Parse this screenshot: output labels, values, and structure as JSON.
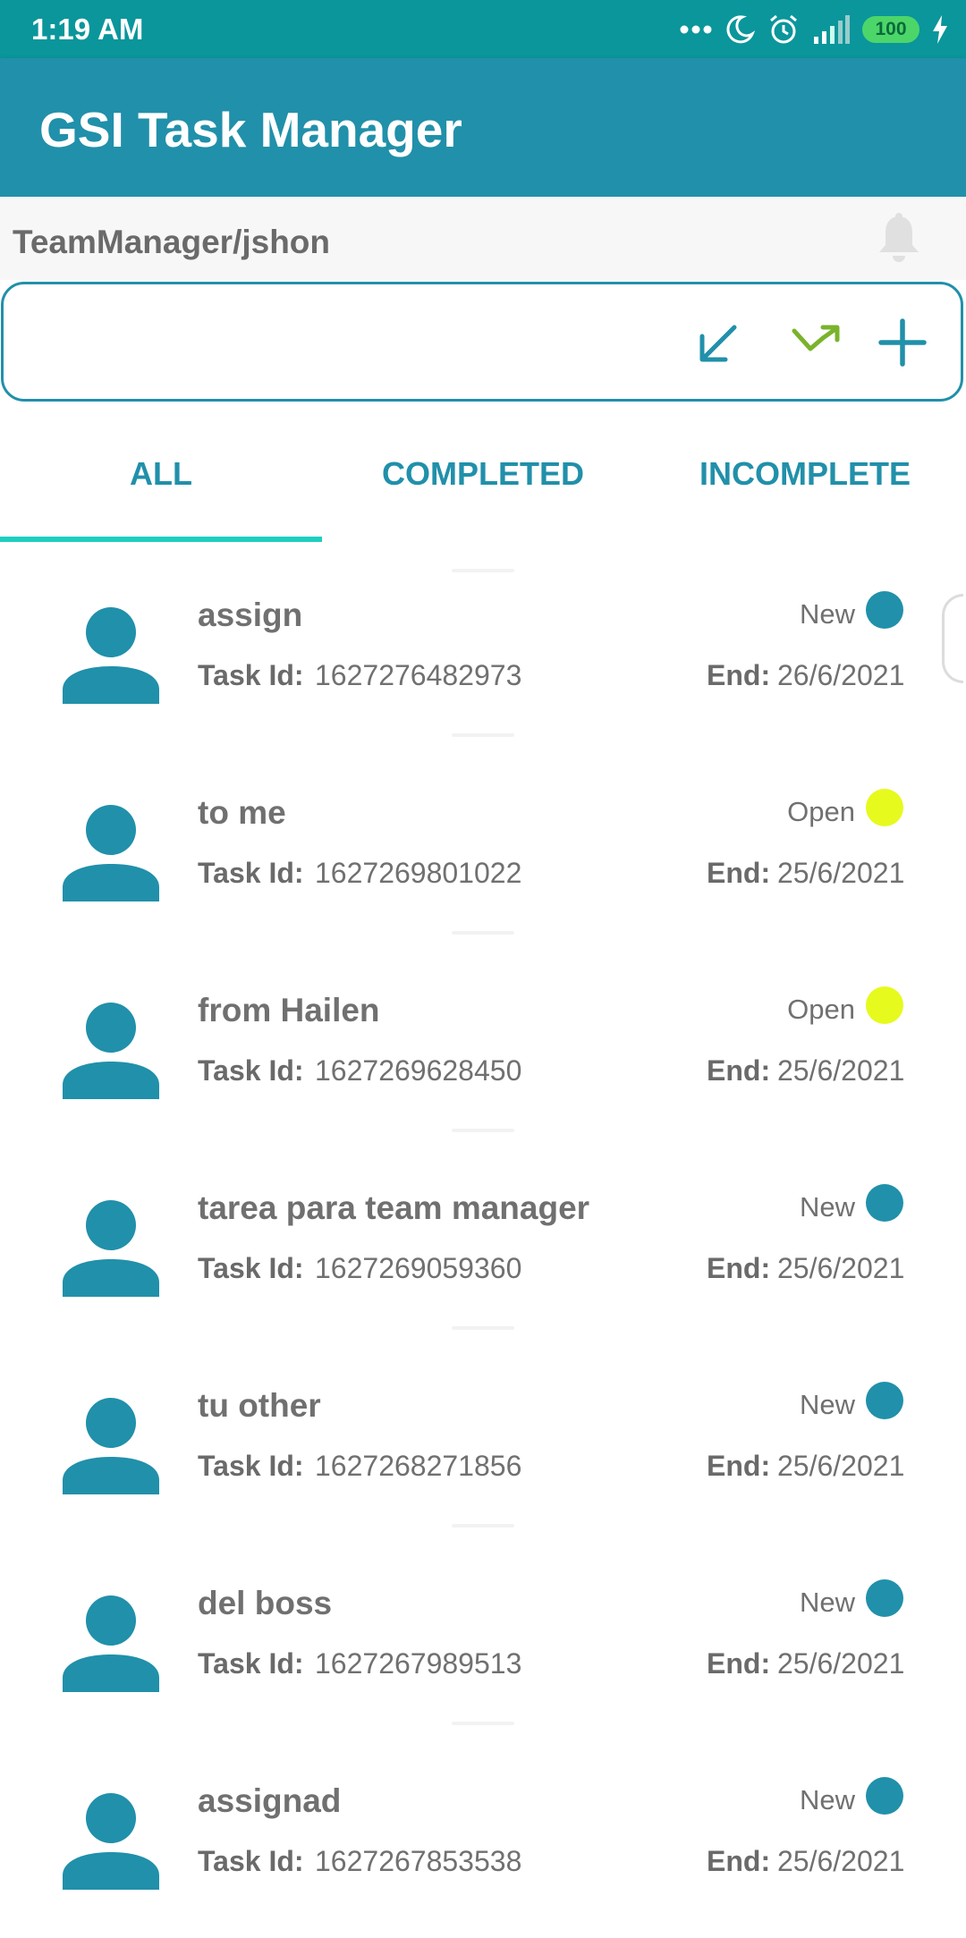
{
  "status_bar": {
    "time": "1:19 AM",
    "battery": "100"
  },
  "app": {
    "title": "GSI Task Manager",
    "accent": "#2190aa",
    "status_bar_color": "#0a969b"
  },
  "user": {
    "path": "TeamManager/jshon"
  },
  "icons": {
    "bell": "bell-icon",
    "incoming": "arrow-down-left-icon",
    "trend": "trend-arrow-icon",
    "add": "plus-icon"
  },
  "tabs": [
    {
      "label": "ALL",
      "selected": true
    },
    {
      "label": "COMPLETED",
      "selected": false
    },
    {
      "label": "INCOMPLETE",
      "selected": false
    }
  ],
  "labels": {
    "task_id": "Task Id:",
    "end": "End:"
  },
  "tasks": [
    {
      "title": "assign",
      "task_id": "1627276482973",
      "status": "New",
      "status_color": "#2190aa",
      "end": "26/6/2021"
    },
    {
      "title": "to me",
      "task_id": "1627269801022",
      "status": "Open",
      "status_color": "#e6fa1e",
      "end": "25/6/2021"
    },
    {
      "title": "from Hailen",
      "task_id": "1627269628450",
      "status": "Open",
      "status_color": "#e6fa1e",
      "end": "25/6/2021"
    },
    {
      "title": "tarea para team manager",
      "task_id": "1627269059360",
      "status": "New",
      "status_color": "#2190aa",
      "end": "25/6/2021"
    },
    {
      "title": "tu other",
      "task_id": "1627268271856",
      "status": "New",
      "status_color": "#2190aa",
      "end": "25/6/2021"
    },
    {
      "title": "del boss",
      "task_id": "1627267989513",
      "status": "New",
      "status_color": "#2190aa",
      "end": "25/6/2021"
    },
    {
      "title": "assignad",
      "task_id": "1627267853538",
      "status": "New",
      "status_color": "#2190aa",
      "end": "25/6/2021"
    }
  ]
}
